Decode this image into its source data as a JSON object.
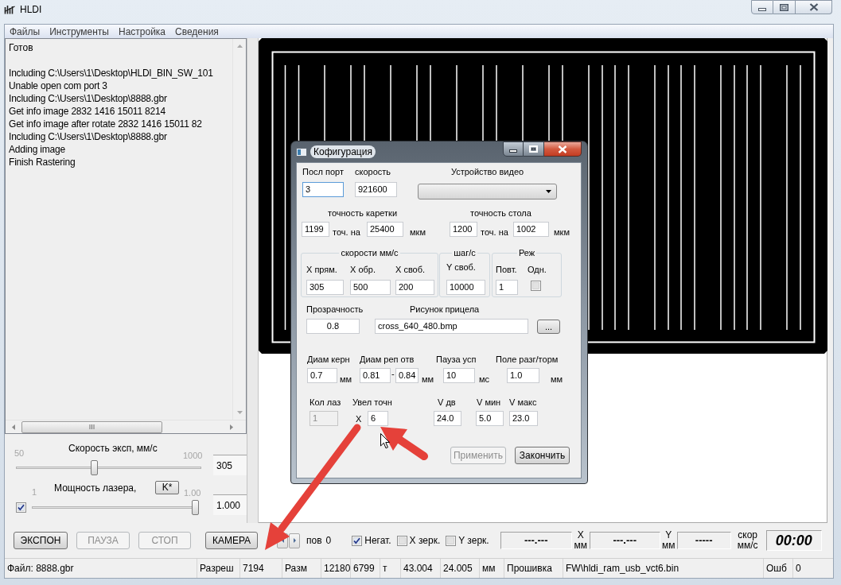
{
  "window": {
    "title": "HLDI"
  },
  "menu": [
    "Файлы",
    "Инструменты",
    "Настройка",
    "Сведения"
  ],
  "log": {
    "status": "Готов",
    "lines": [
      "Including C:\\Users\\1\\Desktop\\HLDI_BIN_SW_101",
      "Unable open com port 3",
      "Including C:\\Users\\1\\Desktop\\8888.gbr",
      "Get info image 2832 1416 15011 8214",
      "Get info image after rotate 2832 1416 15011 82",
      "Including C:\\Users\\1\\Desktop\\8888.gbr",
      "Adding image",
      "Finish Rastering"
    ]
  },
  "exposure_speed": {
    "label": "Скорость эксп, мм/с",
    "min": "50",
    "max": "1000",
    "level": 0.42,
    "reading": "305"
  },
  "laser_power": {
    "label": "Мощность лазера,",
    "min": "1",
    "max": "1.00",
    "level": 1,
    "reading": "1.000",
    "checked": true,
    "button": "K*"
  },
  "buttons": [
    {
      "label": "ЭКСПОН",
      "disabled": false
    },
    {
      "label": "ПАУЗА",
      "disabled": true
    },
    {
      "label": "СТОП",
      "disabled": true
    },
    {
      "label": "КАМЕРА",
      "disabled": false
    }
  ],
  "rotation": {
    "label": "пов",
    "value": "0"
  },
  "options": [
    {
      "label": "Негат.",
      "checked": true
    },
    {
      "label": "X зерк.",
      "checked": false
    },
    {
      "label": "Y зерк.",
      "checked": false
    }
  ],
  "readouts": [
    {
      "value": "---.---",
      "axis": "X",
      "unit": "мм"
    },
    {
      "value": "---.---",
      "axis": "Y",
      "unit": "мм"
    },
    {
      "value": "-----",
      "axis": "скор",
      "unit": "мм/с"
    }
  ],
  "timer": "00:00",
  "status_bar": [
    "Файл: 8888.gbr",
    "Разреш",
    "7194",
    "Разм",
    "12180",
    "6799",
    "т",
    "43.004",
    "24.005",
    "мм",
    "Прошивка",
    "FW\\hldi_ram_usb_vct6.bin",
    "Ошб",
    "0"
  ],
  "dialog": {
    "title": "Кофигурация",
    "serial_port": {
      "label": "Посл порт",
      "value": "3",
      "focused": true
    },
    "baud_rate": {
      "label": "скорость",
      "value": "921600"
    },
    "video_device": {
      "label": "Устройство видео"
    },
    "carriage_precision": {
      "label": "точность каретки",
      "points": "1199",
      "per": "точ. на",
      "distance": "25400",
      "unit": "мкм"
    },
    "table_precision": {
      "label": "точность стола",
      "points": "1200",
      "per": "точ. на",
      "distance": "1002",
      "unit": "мкм"
    },
    "speeds": {
      "title": "скорости мм/с",
      "fields": [
        {
          "label": "X прям.",
          "value": "305"
        },
        {
          "label": "X обр.",
          "value": "500"
        },
        {
          "label": "X своб.",
          "value": "200"
        }
      ]
    },
    "steps": {
      "title": "шаг/с",
      "fields": [
        {
          "label": "Y своб.",
          "value": "10000"
        }
      ]
    },
    "mode": {
      "title": "Реж",
      "repeat": {
        "label": "Повт.",
        "value": "1"
      },
      "single": {
        "label": "Одн.",
        "checked": false
      }
    },
    "transparency": {
      "label": "Прозрачность",
      "value": "0.8"
    },
    "crosshair_image": {
      "label": "Рисунок прицела",
      "value": "cross_640_480.bmp",
      "browse": "..."
    },
    "core_diameter": {
      "label": "Диам керн",
      "value": "0.7",
      "unit": "мм"
    },
    "reference_hole": {
      "label": "Диам реп отв",
      "from": "0.81",
      "separator": "-",
      "to": "0.84",
      "unit": "мм"
    },
    "pause": {
      "label": "Пауза усп",
      "value": "10",
      "unit": "мс"
    },
    "accel_zone": {
      "label": "Поле разг/торм",
      "value": "1.0",
      "unit": "мм"
    },
    "laser_count": {
      "label": "Кол лаз",
      "value": "1",
      "disabled": true
    },
    "precision_gain": {
      "label": "Увел точн",
      "prefix": "X",
      "value": "6"
    },
    "velocities": [
      {
        "label": "V дв",
        "value": "24.0"
      },
      {
        "label": "V мин",
        "value": "5.0"
      },
      {
        "label": "V макс",
        "value": "23.0"
      }
    ],
    "buttons": [
      {
        "label": "Применить",
        "disabled": true
      },
      {
        "label": "Закончить",
        "disabled": false
      }
    ]
  }
}
